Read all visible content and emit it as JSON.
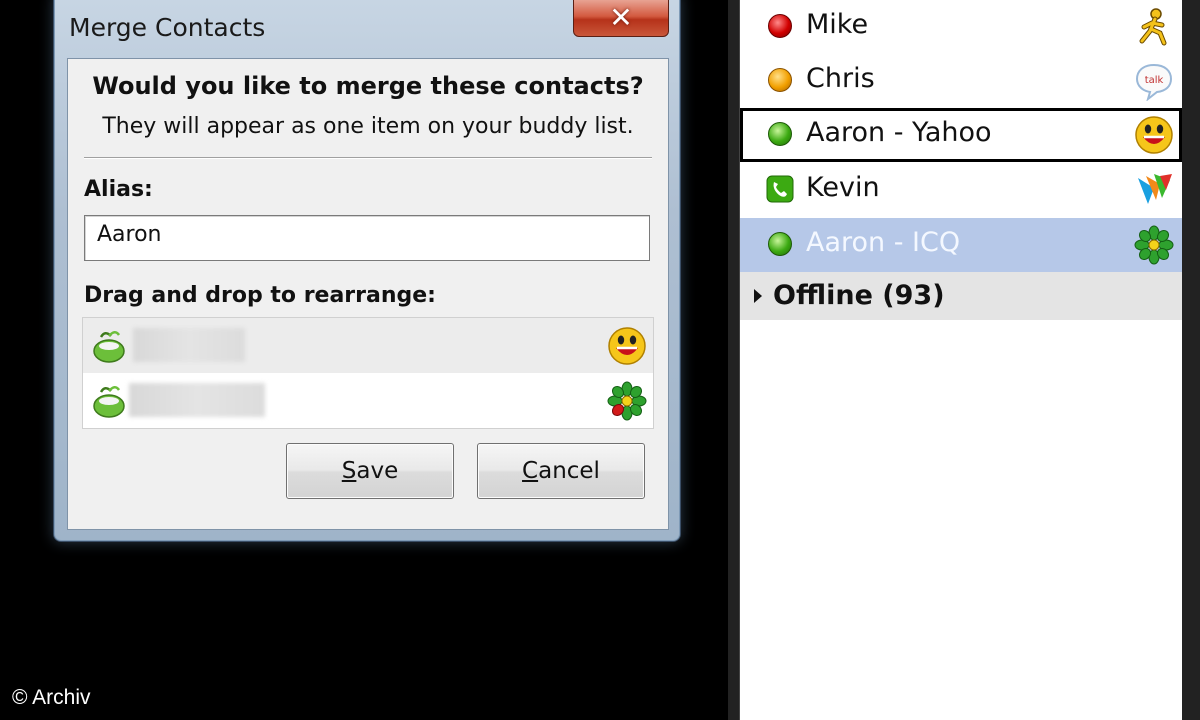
{
  "dialog": {
    "title": "Merge Contacts",
    "close_glyph": "✕",
    "question": "Would you like to merge these contacts?",
    "subtext": "They will appear as one item on your buddy list.",
    "alias_label": "Alias:",
    "alias_value": "Aaron",
    "drag_label": "Drag and drop to rearrange:",
    "drag_items": [
      {
        "icon": "pidgin-icon",
        "protocol_icon": "yahoo-icon"
      },
      {
        "icon": "pidgin-icon",
        "protocol_icon": "icq-icon"
      }
    ],
    "save": {
      "accel": "S",
      "rest": "ave"
    },
    "cancel": {
      "accel": "C",
      "rest": "ancel"
    }
  },
  "buddy_list": {
    "buddies": [
      {
        "name": "Mike",
        "status": "busy",
        "status_color": "#d10000",
        "protocol_icon": "aim-icon"
      },
      {
        "name": "Chris",
        "status": "away",
        "status_color": "#f2a000",
        "protocol_icon": "gtalk-icon"
      },
      {
        "name": "Aaron - Yahoo",
        "status": "available",
        "status_color": "#3caa12",
        "protocol_icon": "yahoo-icon"
      },
      {
        "name": "Kevin",
        "status": "mobile",
        "status_color": "#3caa12",
        "protocol_icon": "msn-icon"
      },
      {
        "name": "Aaron - ICQ",
        "status": "available",
        "status_color": "#3caa12",
        "protocol_icon": "icq-icon"
      }
    ],
    "group": {
      "label": "Offline (93)"
    }
  },
  "watermark": "© Archiv",
  "colors": {
    "highlight": "#b6c8e8",
    "close_button": "#c9573a"
  }
}
